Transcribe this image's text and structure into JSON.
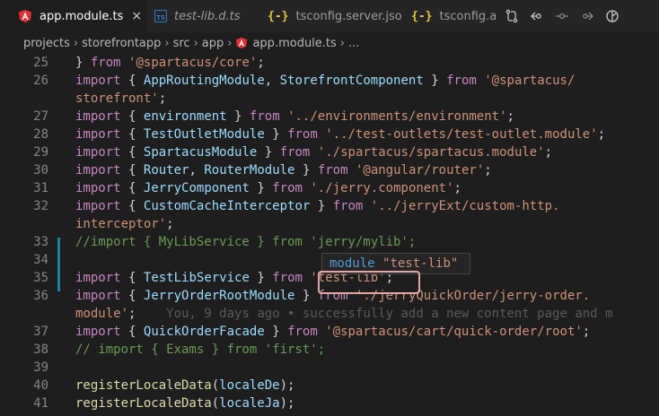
{
  "tabs": [
    {
      "label": "app.module.ts",
      "icon": "angular-icon",
      "close": "×"
    },
    {
      "label": "test-lib.d.ts",
      "icon": "typescript-file-icon"
    },
    {
      "label": "tsconfig.server.json",
      "icon": "json-braces-icon"
    },
    {
      "label": "tsconfig.a",
      "icon": "json-braces-icon"
    }
  ],
  "actions": [
    "compare-changes-icon",
    "go-back-icon",
    "toggle-change-icon",
    "go-forward-icon",
    "open-changes-icon"
  ],
  "breadcrumb": {
    "items": [
      "projects",
      "storefrontapp",
      "src",
      "app",
      "app.module.ts",
      "..."
    ]
  },
  "code_lines": [
    {
      "n": "25",
      "code": "} from '@spartacus/core';"
    },
    {
      "n": "26",
      "code": "import { AppRoutingModule, StorefrontComponent } from '@spartacus/"
    },
    {
      "n": "",
      "code": "storefront';"
    },
    {
      "n": "27",
      "code": "import { environment } from '../environments/environment';"
    },
    {
      "n": "28",
      "code": "import { TestOutletModule } from '../test-outlets/test-outlet.module';"
    },
    {
      "n": "29",
      "code": "import { SpartacusModule } from './spartacus/spartacus.module';"
    },
    {
      "n": "30",
      "code": "import { Router, RouterModule } from '@angular/router';"
    },
    {
      "n": "31",
      "code": "import { JerryComponent } from './jerry.component';"
    },
    {
      "n": "32",
      "code": "import { CustomCacheInterceptor } from '../jerryExt/custom-http."
    },
    {
      "n": "",
      "code": "interceptor';"
    },
    {
      "n": "33",
      "code": "//import { MyLibService } from 'jerry/mylib';"
    },
    {
      "n": "34",
      "code": ""
    },
    {
      "n": "35",
      "code": "import { TestLibService } from 'test-lib';"
    },
    {
      "n": "36",
      "code": "import { JerryOrderRootModule } from './jerryQuickOrder/jerry-order."
    },
    {
      "n": "",
      "code": "module';",
      "blame": "    You, 9 days ago • successfully add a new content page and m"
    },
    {
      "n": "37",
      "code": "import { QuickOrderFacade } from '@spartacus/cart/quick-order/root';"
    },
    {
      "n": "38",
      "code": "// import { Exams } from 'first';"
    },
    {
      "n": "39",
      "code": ""
    },
    {
      "n": "40",
      "code": "registerLocaleData(localeDe);"
    },
    {
      "n": "41",
      "code": "registerLocaleData(localeJa);"
    }
  ],
  "hover": {
    "keyword": "module",
    "name": "\"test-lib\""
  },
  "colors": {
    "accent": "#1b81a8",
    "highlight_border": "#e7a5a5",
    "angular": "#e23237",
    "ts": "#3178c6",
    "json": "#e8c541"
  }
}
